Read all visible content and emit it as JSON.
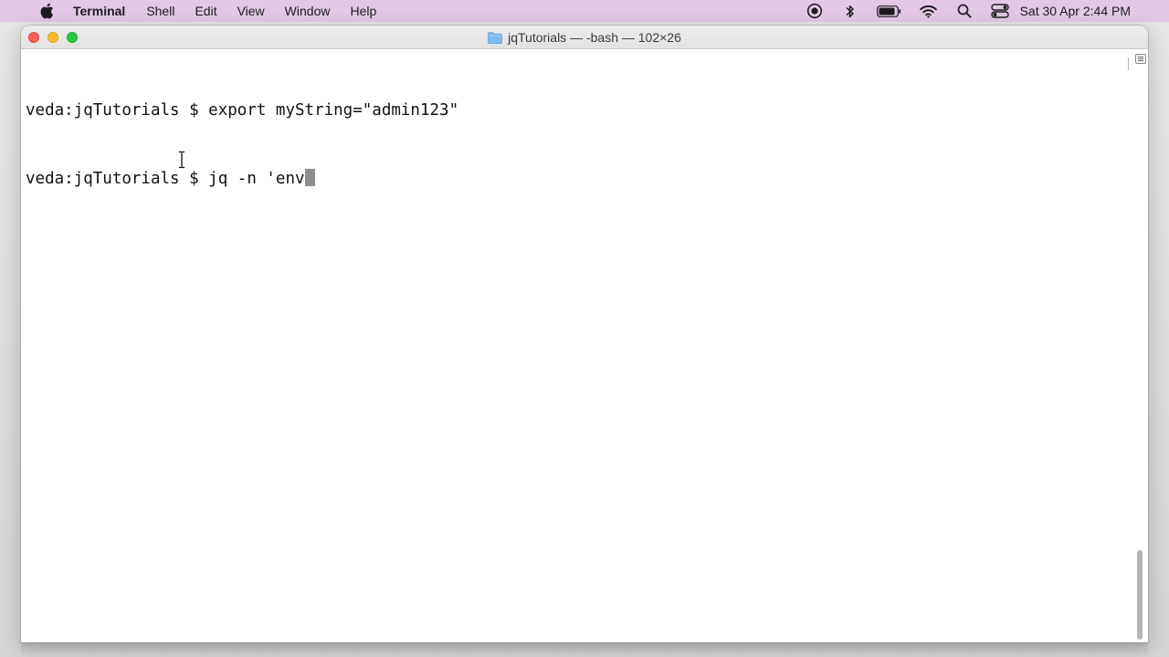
{
  "menubar": {
    "app_name": "Terminal",
    "items": [
      "Shell",
      "Edit",
      "View",
      "Window",
      "Help"
    ],
    "clock": "Sat 30 Apr  2:44 PM",
    "background": "#e3c9e6",
    "status_icons": [
      "screen-record-icon",
      "bluetooth-icon",
      "battery-icon",
      "wifi-icon",
      "search-icon",
      "control-center-icon"
    ]
  },
  "window": {
    "title": "jqTutorials — -bash — 102×26",
    "title_icon": "folder-icon"
  },
  "terminal": {
    "lines": [
      "veda:jqTutorials $ export myString=\"admin123\"",
      "veda:jqTutorials $ jq -n 'env"
    ]
  }
}
